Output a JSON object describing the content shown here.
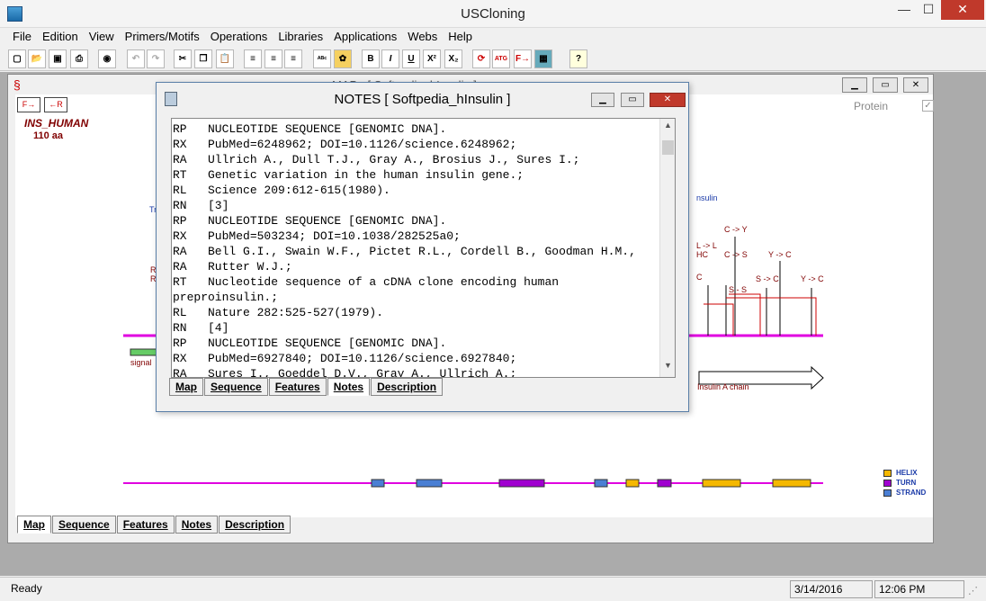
{
  "app": {
    "title": "USCloning",
    "minimize": "—",
    "maximize": "☐",
    "close": "✕"
  },
  "menu": [
    "File",
    "Edition",
    "View",
    "Primers/Motifs",
    "Operations",
    "Libraries",
    "Applications",
    "Webs",
    "Help"
  ],
  "toolbar": {
    "buttons": [
      "new-icon",
      "open-icon",
      "save-icon",
      "print-icon",
      "camera-icon",
      "undo-icon",
      "redo-icon",
      "cut-icon",
      "copy-icon",
      "paste-icon",
      "align-left-icon",
      "align-center-icon",
      "align-right-icon",
      "abc-icon",
      "palette-icon",
      "bold-icon",
      "italic-icon",
      "underline-icon",
      "superscript-icon",
      "subscript-icon",
      "refresh-icon",
      "atg-icon",
      "primer-icon",
      "table-icon",
      "help-icon"
    ],
    "labels": {
      "bold": "B",
      "italic": "I",
      "underline": "U",
      "superscript": "X²",
      "subscript": "X₂",
      "help": "?"
    }
  },
  "map_window": {
    "title": "MAP - [ Softpedia_hInsulin ]",
    "protein_label": "Protein",
    "protein_checked": true,
    "sequence_name": "INS_HUMAN",
    "length": "110 aa",
    "labels": {
      "tryp": "Tryp",
      "insulin": "nsulin",
      "r1": "R ->",
      "r2": "R ->",
      "lv": "L -> L",
      "hc": "HC",
      "cs": "C -> S",
      "cy": "C -> Y",
      "yc1": "Y -> C",
      "yc2": "Y -> C",
      "ss": "S -> C",
      "sdash": "S - S",
      "c": "C",
      "signal": "signal",
      "insulin_a": "Insulin A chain"
    },
    "legend": [
      {
        "label": "HELIX",
        "color": "#f5b800"
      },
      {
        "label": "TURN",
        "color": "#a000d0"
      },
      {
        "label": "STRAND",
        "color": "#4a7fd4"
      }
    ],
    "tabs": [
      "Map",
      "Sequence",
      "Features",
      "Notes",
      "Description"
    ],
    "active_tab": "Map"
  },
  "notes_window": {
    "title": "NOTES   [ Softpedia_hInsulin ]",
    "lines": [
      "RP   NUCLEOTIDE SEQUENCE [GENOMIC DNA].",
      "RX   PubMed=6248962; DOI=10.1126/science.6248962;",
      "RA   Ullrich A., Dull T.J., Gray A., Brosius J., Sures I.;",
      "RT   Genetic variation in the human insulin gene.;",
      "RL   Science 209:612-615(1980).",
      "RN   [3]",
      "RP   NUCLEOTIDE SEQUENCE [GENOMIC DNA].",
      "RX   PubMed=503234; DOI=10.1038/282525a0;",
      "RA   Bell G.I., Swain W.F., Pictet R.L., Cordell B., Goodman H.M.,",
      "RA   Rutter W.J.;",
      "RT   Nucleotide sequence of a cDNA clone encoding human",
      "preproinsulin.;",
      "RL   Nature 282:525-527(1979).",
      "RN   [4]",
      "RP   NUCLEOTIDE SEQUENCE [GENOMIC DNA].",
      "RX   PubMed=6927840; DOI=10.1126/science.6927840;",
      "RA   Sures I., Goeddel D.V., Gray A., Ullrich A.;"
    ],
    "tabs": [
      "Map",
      "Sequence",
      "Features",
      "Notes",
      "Description"
    ],
    "active_tab": "Notes"
  },
  "status": {
    "left": "Ready",
    "date": "3/14/2016",
    "time": "12:06 PM"
  },
  "colors": {
    "magenta": "#e000e0",
    "darkred": "#800000",
    "navy": "#1a3aa8"
  }
}
